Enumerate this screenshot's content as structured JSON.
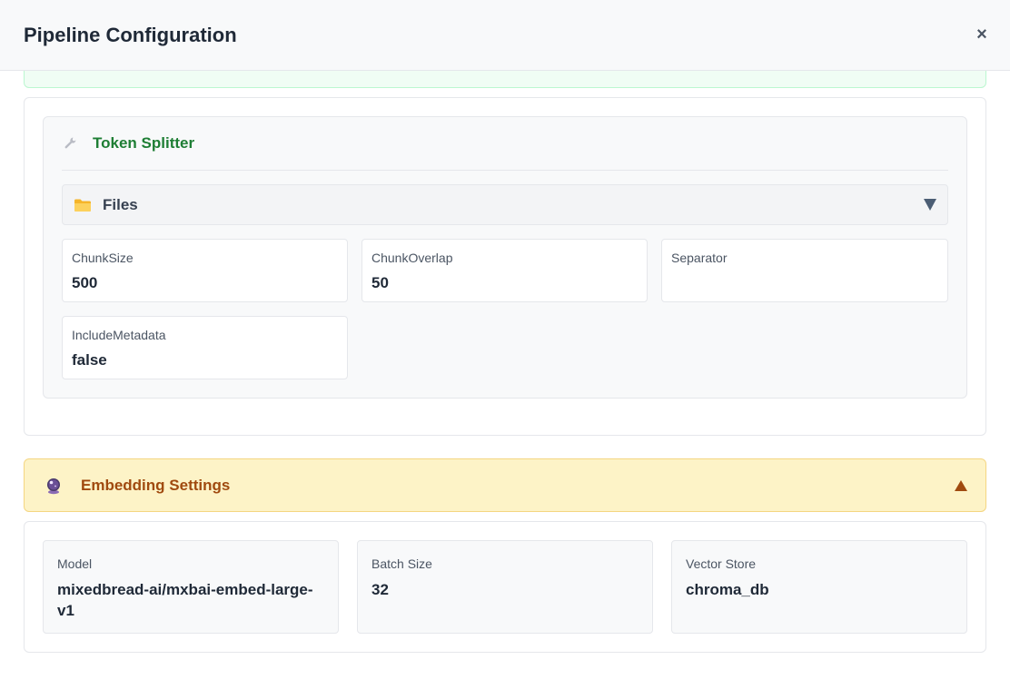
{
  "header": {
    "title": "Pipeline Configuration",
    "close_label": "×"
  },
  "splitter": {
    "title": "Token Splitter",
    "icon": "wrench-icon",
    "files": {
      "label": "Files",
      "icon": "folder-icon",
      "expanded": false
    },
    "fields": [
      {
        "label": "ChunkSize",
        "value": "500"
      },
      {
        "label": "ChunkOverlap",
        "value": "50"
      },
      {
        "label": "Separator",
        "value": ""
      },
      {
        "label": "IncludeMetadata",
        "value": "false"
      }
    ]
  },
  "embedding": {
    "title": "Embedding Settings",
    "icon": "crystal-ball-icon",
    "expanded": true,
    "fields": [
      {
        "label": "Model",
        "value": "mixedbread-ai/mxbai-embed-large-v1"
      },
      {
        "label": "Batch Size",
        "value": "32"
      },
      {
        "label": "Vector Store",
        "value": "chroma_db"
      }
    ]
  },
  "colors": {
    "splitter_title": "#1e7e34",
    "embedding_bar_bg": "#fdf3c7",
    "embedding_title": "#a04a0f",
    "success_strip": "#f0fdf4"
  }
}
